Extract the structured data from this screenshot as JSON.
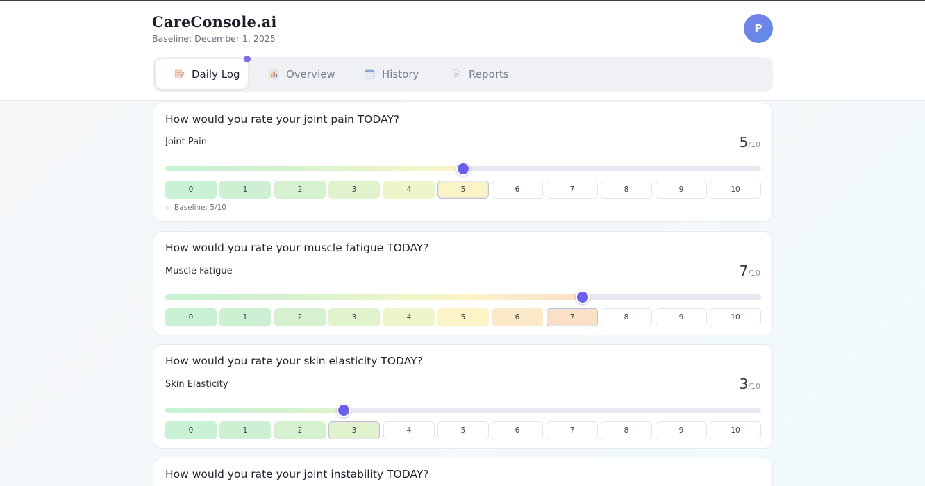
{
  "app": {
    "brand": "CareConsole.ai",
    "baseline_date": "Baseline: December 1, 2025",
    "avatar_initial": "P"
  },
  "tabs": [
    {
      "label": "Daily Log",
      "icon": "pencil-memo-icon",
      "active": true
    },
    {
      "label": "Overview",
      "icon": "bar-chart-icon",
      "active": false
    },
    {
      "label": "History",
      "icon": "calendar-icon",
      "active": false
    },
    {
      "label": "Reports",
      "icon": "document-icon",
      "active": false
    }
  ],
  "scale": {
    "options": [
      "0",
      "1",
      "2",
      "3",
      "4",
      "5",
      "6",
      "7",
      "8",
      "9",
      "10"
    ],
    "max_suffix": "/10",
    "level_colors": [
      "#c9f2d4",
      "#cdf0d2",
      "#d6f1cf",
      "#e1f3cd",
      "#edf6c8",
      "#fbf4c7",
      "#fbe9c7",
      "#fbe0c6",
      "#fdd9c6",
      "#fdd0c6",
      "#fdc8c6"
    ],
    "thumb_color": "#6a5ff0",
    "track_color": "#e6e8f2"
  },
  "questions": [
    {
      "question": "How would you rate your joint pain TODAY?",
      "label": "Joint Pain",
      "value": 5,
      "score_text": "5",
      "baseline": "Baseline: 5/10"
    },
    {
      "question": "How would you rate your muscle fatigue TODAY?",
      "label": "Muscle Fatigue",
      "value": 7,
      "score_text": "7",
      "baseline": ""
    },
    {
      "question": "How would you rate your skin elasticity TODAY?",
      "label": "Skin Elasticity",
      "value": 3,
      "score_text": "3",
      "baseline": ""
    },
    {
      "question": "How would you rate your joint instability TODAY?",
      "label": "",
      "value": null,
      "score_text": "",
      "baseline": ""
    }
  ]
}
